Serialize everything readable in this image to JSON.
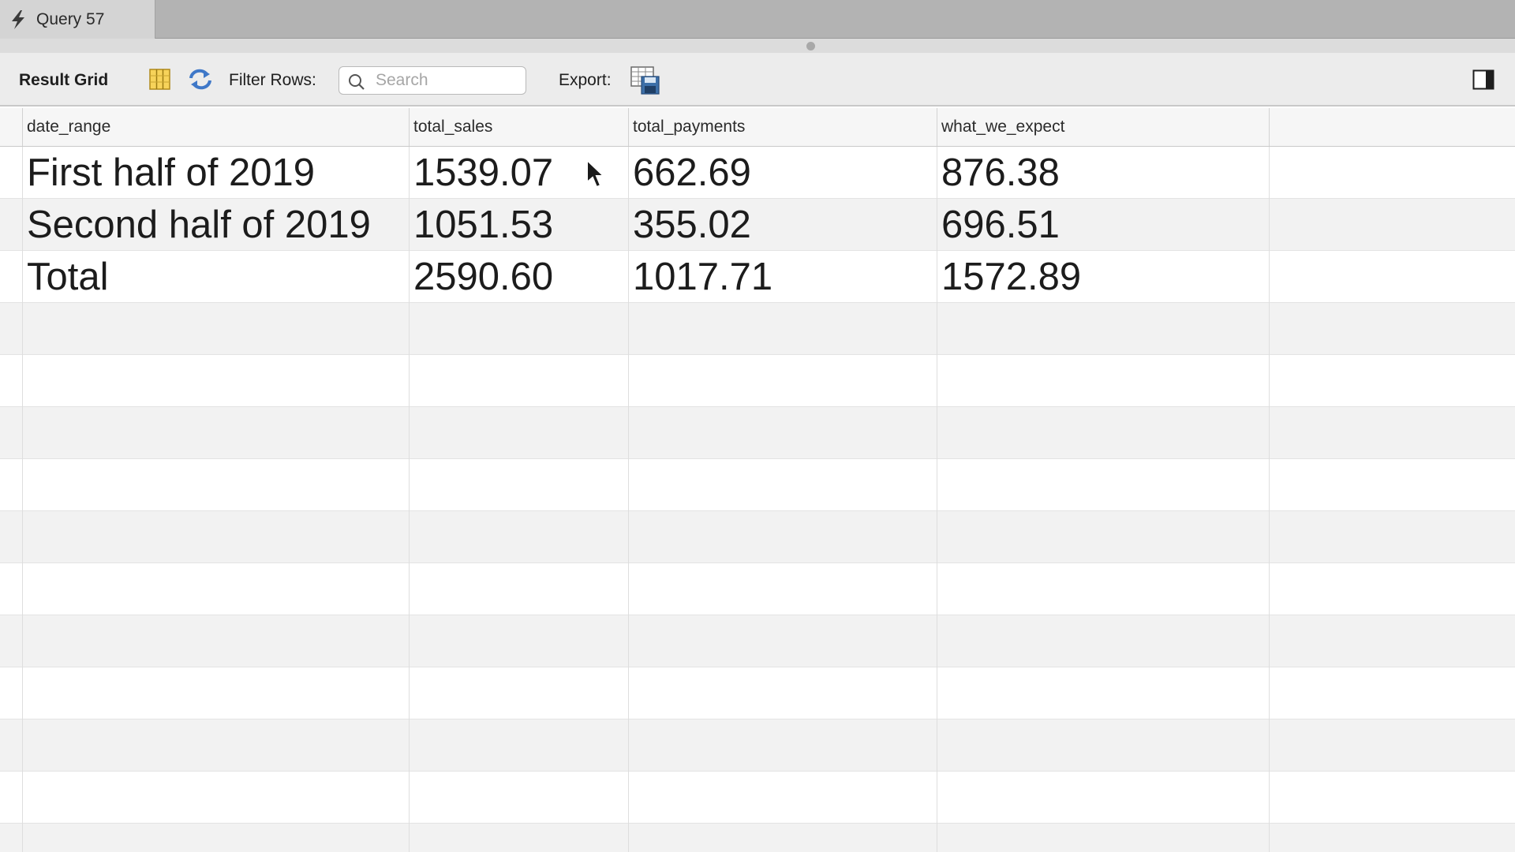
{
  "tab": {
    "label": "Query 57",
    "icon": "lightning-bolt-icon"
  },
  "toolbar": {
    "result_grid_label": "Result Grid",
    "filter_label": "Filter Rows:",
    "search_placeholder": "Search",
    "export_label": "Export:"
  },
  "grid": {
    "columns": [
      "date_range",
      "total_sales",
      "total_payments",
      "what_we_expect"
    ],
    "rows": [
      [
        "First half of 2019",
        "1539.07",
        "662.69",
        "876.38"
      ],
      [
        "Second half of 2019",
        "1051.53",
        "355.02",
        "696.51"
      ],
      [
        "Total",
        "2590.60",
        "1017.71",
        "1572.89"
      ]
    ]
  },
  "colors": {
    "tabbar": "#b3b3b3",
    "toolbar": "#ececec",
    "row_alt": "#f2f2f2",
    "accent_blue": "#3f78c8",
    "icon_yellow": "#f2c230"
  }
}
